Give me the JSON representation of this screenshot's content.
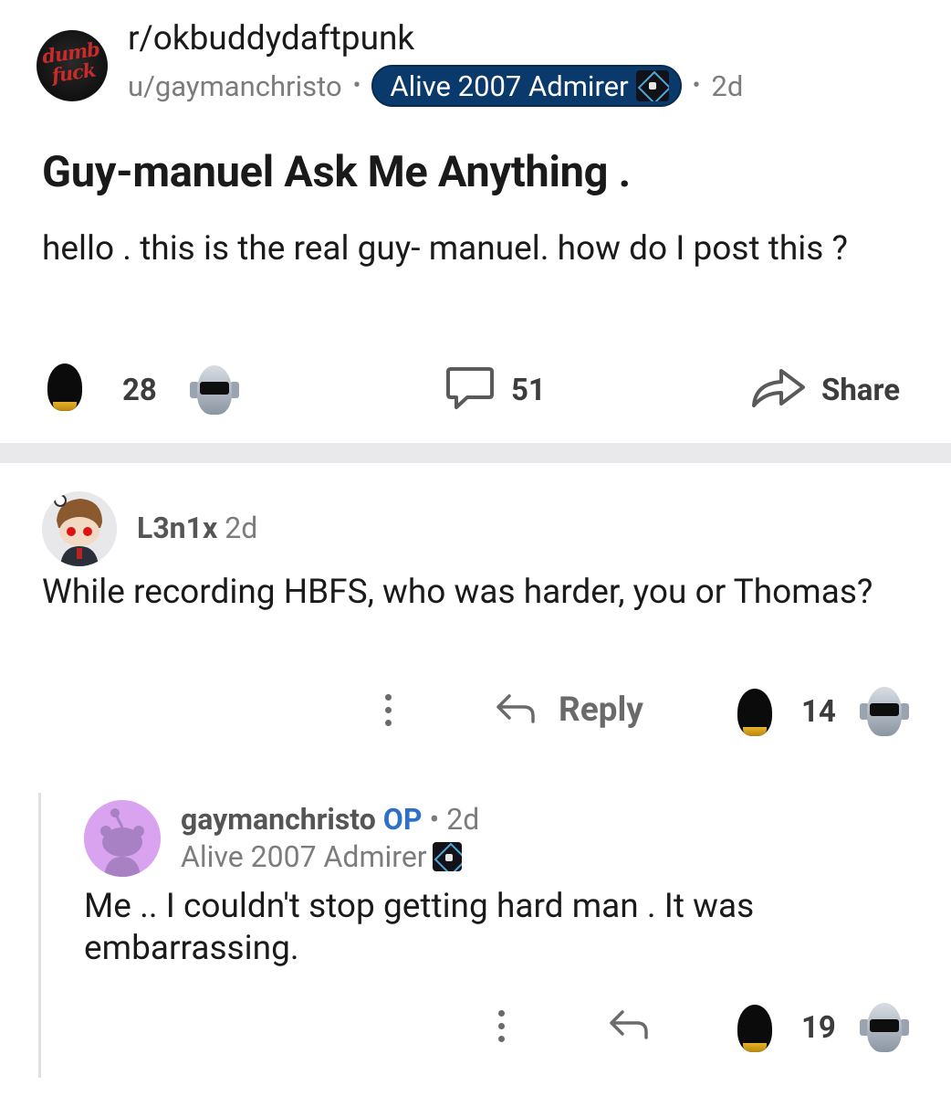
{
  "post": {
    "subreddit": "r/okbuddydaftpunk",
    "subreddit_logo_text": "dumb\nfuck",
    "author": "u/gaymanchristo",
    "separator": "•",
    "flair": "Alive 2007 Admirer",
    "time": "2d",
    "title": "Guy-manuel Ask Me Anything .",
    "body": "hello .  this is the real guy- manuel. how do I post this ?",
    "score": "28",
    "comments": "51",
    "share_label": "Share"
  },
  "comments": [
    {
      "user": "L3n1x",
      "time": "2d",
      "body": "While recording HBFS, who was harder, you or Thomas?",
      "reply_label": "Reply",
      "score": "14"
    },
    {
      "user": "gaymanchristo",
      "op_label": "OP",
      "separator": "•",
      "time": "2d",
      "flair": "Alive 2007 Admirer",
      "body": "Me .. I couldn't stop getting hard man . It was embarrassing.",
      "score": "19"
    }
  ],
  "colors": {
    "flair_bg": "#0a3a6b",
    "op_blue": "#2f6ec9",
    "divider": "#e9e9eb",
    "avatar_purple": "#d9a3ef"
  },
  "icons": {
    "upvote": "gold-helmet-icon",
    "downvote": "silver-helmet-icon",
    "comments": "comment-bubble-icon",
    "share": "share-arrow-icon",
    "reply": "reply-arrow-icon",
    "more": "kebab-menu-icon"
  }
}
